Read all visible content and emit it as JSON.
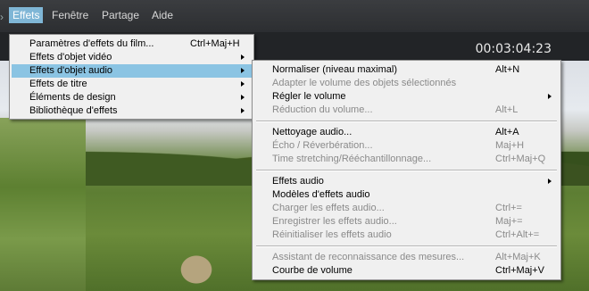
{
  "menubar": {
    "items": [
      "Effets",
      "Fenêtre",
      "Partage",
      "Aide"
    ]
  },
  "timecode": "00:03:04:23",
  "menu_main": {
    "items": [
      {
        "label": "Paramètres d'effets du film...",
        "shortcut": "Ctrl+Maj+H"
      },
      {
        "label": "Effets d'objet vidéo",
        "submenu": true
      },
      {
        "label": "Effets d'objet audio",
        "submenu": true,
        "highlighted": true
      },
      {
        "label": "Effets de titre",
        "submenu": true
      },
      {
        "label": "Éléments de design",
        "submenu": true
      },
      {
        "label": "Bibliothèque d'effets",
        "submenu": true
      }
    ]
  },
  "menu_sub": {
    "items": [
      {
        "label": "Normaliser (niveau maximal)",
        "shortcut": "Alt+N"
      },
      {
        "label": "Adapter le volume des objets sélectionnés",
        "disabled": true
      },
      {
        "label": "Régler le volume",
        "submenu": true
      },
      {
        "label": "Réduction du volume...",
        "shortcut": "Alt+L",
        "disabled": true
      },
      {
        "label": "Nettoyage audio...",
        "shortcut": "Alt+A"
      },
      {
        "label": "Écho / Réverbération...",
        "shortcut": "Maj+H",
        "disabled": true
      },
      {
        "label": "Time stretching/Rééchantillonnage...",
        "shortcut": "Ctrl+Maj+Q",
        "disabled": true
      },
      {
        "label": "Effets audio",
        "submenu": true
      },
      {
        "label": "Modèles d'effets audio"
      },
      {
        "label": "Charger les effets audio...",
        "shortcut": "Ctrl+=",
        "disabled": true
      },
      {
        "label": "Enregistrer les effets audio...",
        "shortcut": "Maj+=",
        "disabled": true
      },
      {
        "label": "Réinitialiser les effets audio",
        "shortcut": "Ctrl+Alt+=",
        "disabled": true
      },
      {
        "label": "Assistant de reconnaissance des mesures...",
        "shortcut": "Alt+Maj+K",
        "disabled": true
      },
      {
        "label": "Courbe de volume",
        "shortcut": "Ctrl+Maj+V"
      }
    ]
  }
}
